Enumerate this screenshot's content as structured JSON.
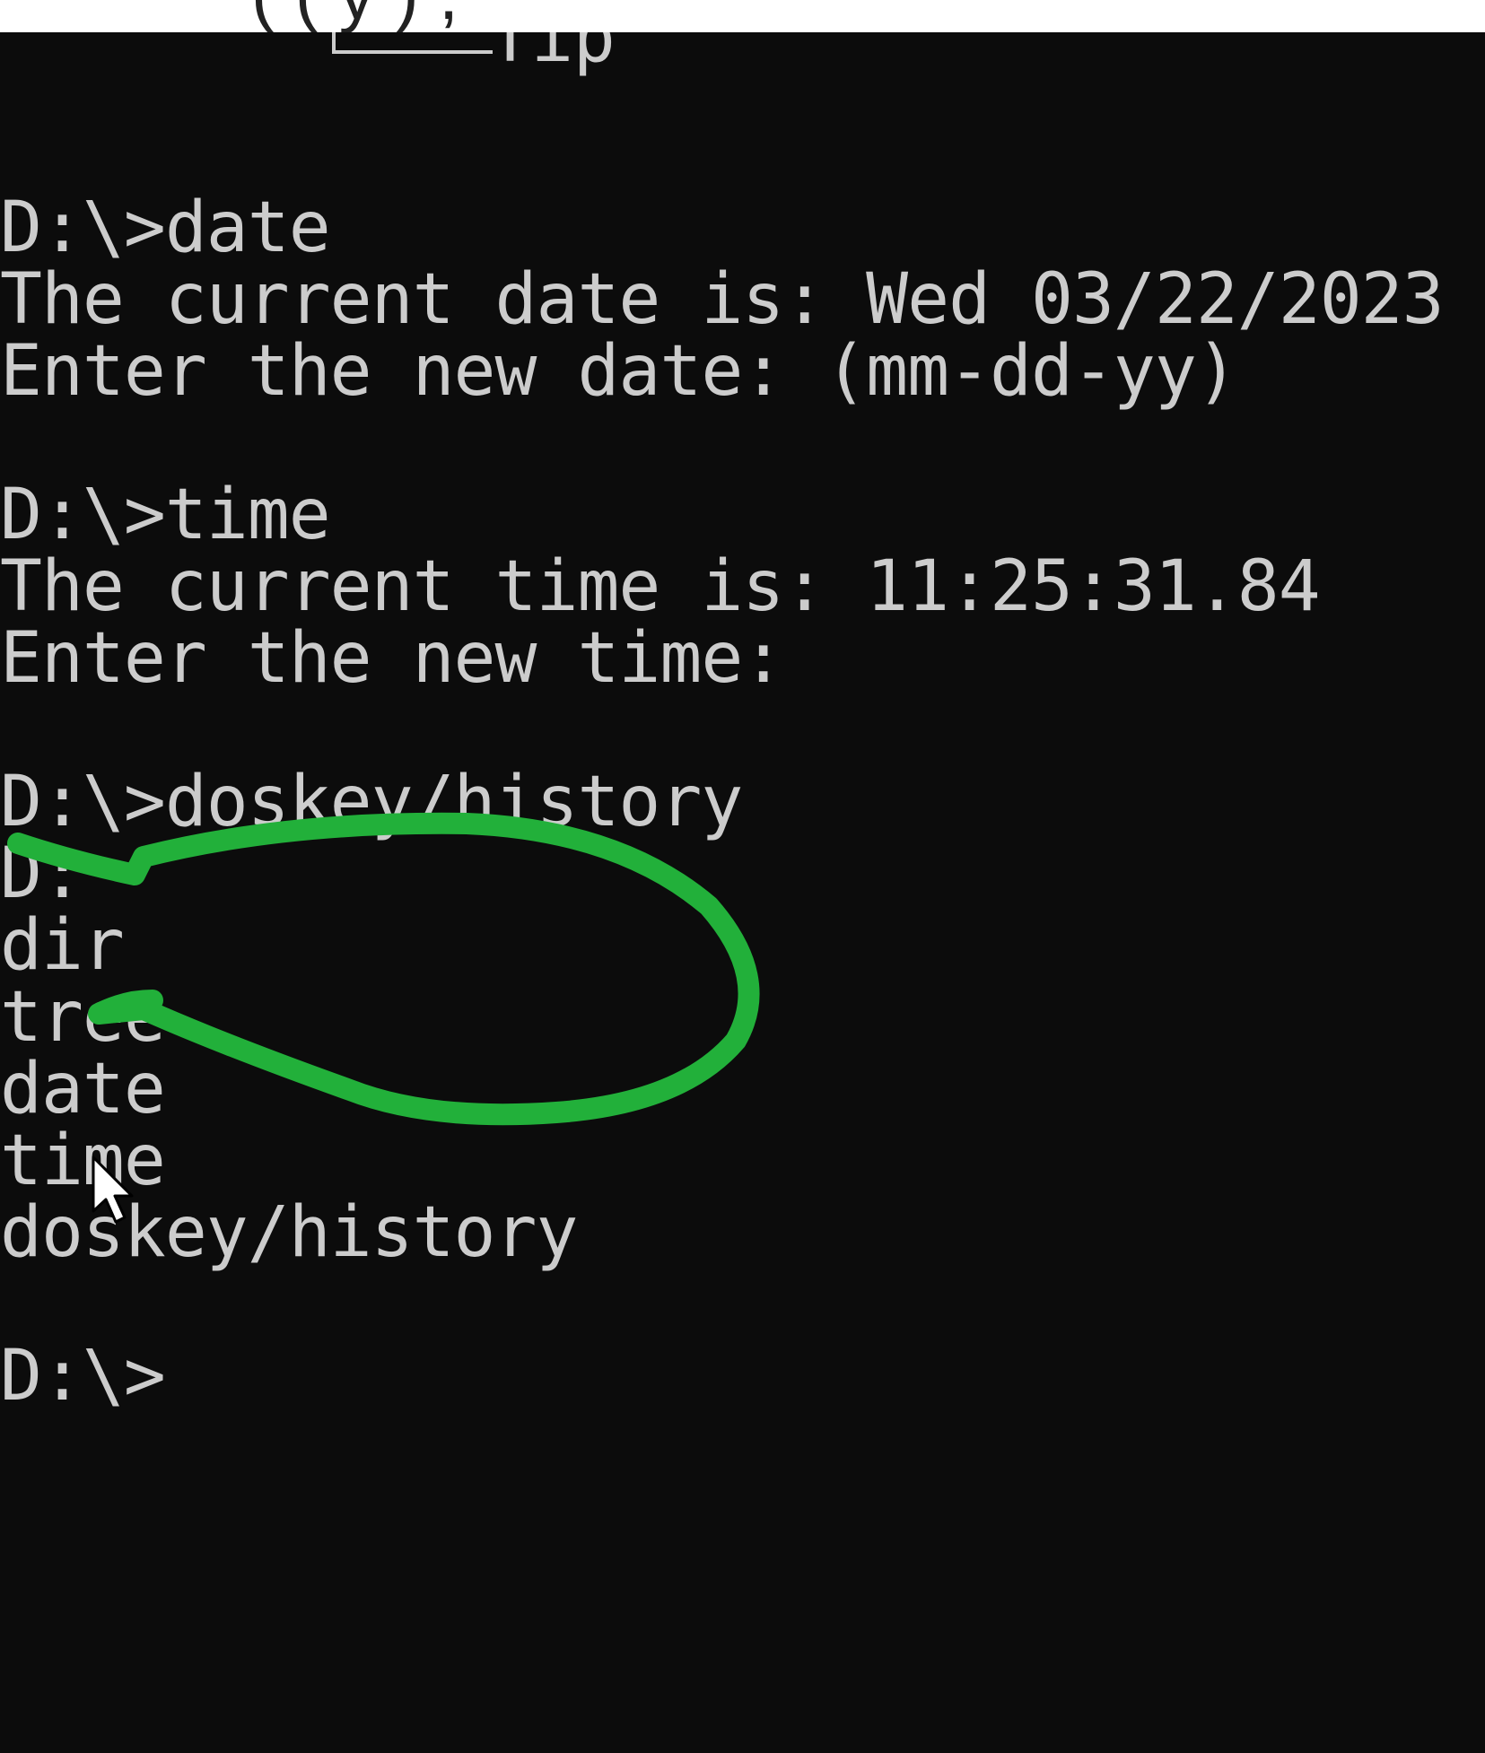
{
  "top_partial_text": "( (   y ) ,",
  "terminal": {
    "tree_fragment_label": "Tip",
    "lines": [
      "D:\\>date",
      "The current date is: Wed 03/22/2023",
      "Enter the new date: (mm-dd-yy)",
      "",
      "D:\\>time",
      "The current time is: 11:25:31.84",
      "Enter the new time:",
      "",
      "D:\\>doskey/history",
      "D:",
      "dir",
      "tree",
      "date",
      "time",
      "doskey/history",
      "",
      "D:\\>"
    ]
  },
  "colors": {
    "terminal_bg": "#0c0c0c",
    "terminal_text": "#cccccc",
    "annotation_stroke": "#22b03a"
  },
  "icons": {
    "cursor": "mouse-pointer-icon",
    "annotation": "hand-drawn-circle"
  }
}
